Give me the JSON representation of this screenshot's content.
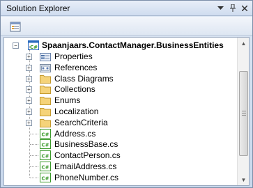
{
  "window": {
    "title": "Solution Explorer",
    "controls": {
      "dropdown": "▾",
      "pin": "📌",
      "close": "✕"
    }
  },
  "toolbar": {
    "properties_icon": "properties-icon"
  },
  "tree": {
    "project": {
      "label": "Spaanjaars.ContactManager.BusinessEntities",
      "expander": "−"
    },
    "items": [
      {
        "label": "Properties",
        "icon": "properties-folder-icon",
        "expander": "+"
      },
      {
        "label": "References",
        "icon": "references-icon",
        "expander": "+"
      },
      {
        "label": "Class Diagrams",
        "icon": "folder-icon",
        "expander": "+"
      },
      {
        "label": "Collections",
        "icon": "folder-icon",
        "expander": "+"
      },
      {
        "label": "Enums",
        "icon": "folder-icon",
        "expander": "+"
      },
      {
        "label": "Localization",
        "icon": "folder-icon",
        "expander": "+"
      },
      {
        "label": "SearchCriteria",
        "icon": "folder-icon",
        "expander": "+"
      },
      {
        "label": "Address.cs",
        "icon": "csharp-file-icon"
      },
      {
        "label": "BusinessBase.cs",
        "icon": "csharp-file-icon"
      },
      {
        "label": "ContactPerson.cs",
        "icon": "csharp-file-icon"
      },
      {
        "label": "EmailAddress.cs",
        "icon": "csharp-file-icon"
      },
      {
        "label": "PhoneNumber.cs",
        "icon": "csharp-file-icon"
      }
    ]
  },
  "scrollbar": {
    "up": "▲",
    "down": "▼"
  },
  "colors": {
    "folder": "#f5d37a",
    "csharp_green": "#3a9a2a",
    "project_blue": "#2a6bbf"
  }
}
